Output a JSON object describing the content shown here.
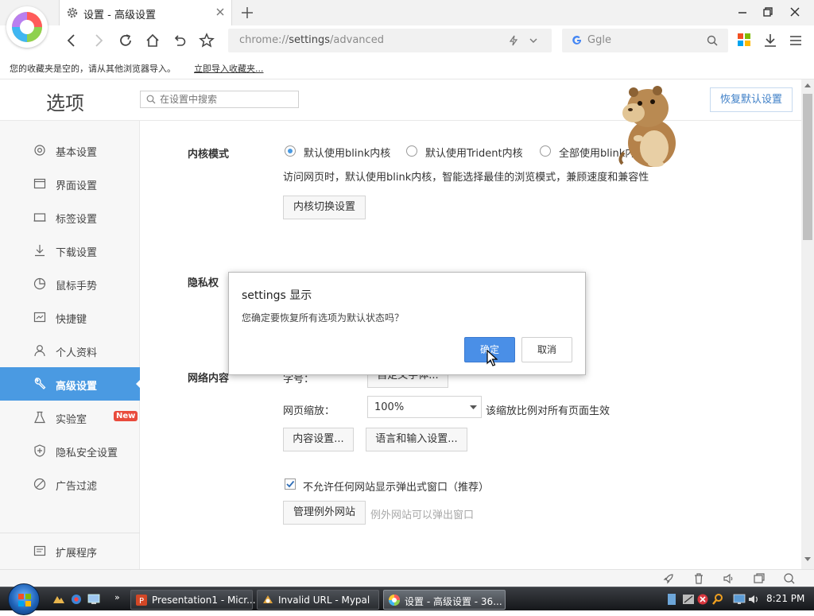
{
  "tab": {
    "title": "设置 - 高级设置"
  },
  "toolbar": {
    "url_prefix": "chrome://",
    "url_host": "settings",
    "url_path": "/advanced",
    "search_placeholder": "Ggle"
  },
  "bookmarks": {
    "empty_text": "您的收藏夹是空的，请从其他浏览器导入。",
    "import_link": "立即导入收藏夹..."
  },
  "settings": {
    "page_title": "选项",
    "search_placeholder": "在设置中搜索",
    "restore_button": "恢复默认设置"
  },
  "sidebar": {
    "items": [
      {
        "label": "基本设置",
        "icon": "gear-icon"
      },
      {
        "label": "界面设置",
        "icon": "window-icon"
      },
      {
        "label": "标签设置",
        "icon": "tab-icon"
      },
      {
        "label": "下载设置",
        "icon": "download-icon"
      },
      {
        "label": "鼠标手势",
        "icon": "mouse-icon"
      },
      {
        "label": "快捷键",
        "icon": "keyboard-icon"
      },
      {
        "label": "个人资料",
        "icon": "user-icon"
      },
      {
        "label": "高级设置",
        "icon": "wrench-icon",
        "active": true
      },
      {
        "label": "实验室",
        "icon": "flask-icon",
        "badge": "New"
      },
      {
        "label": "隐私安全设置",
        "icon": "shield-icon"
      },
      {
        "label": "广告过滤",
        "icon": "block-icon"
      },
      {
        "label": "扩展程序",
        "icon": "extension-icon"
      }
    ]
  },
  "kernel": {
    "title": "内核模式",
    "options": [
      "默认使用blink内核",
      "默认使用Trident内核",
      "全部使用blink内核"
    ],
    "selected_index": 0,
    "description": "访问网页时，默认使用blink内核，智能选择最佳的浏览模式，兼顾速度和兼容性",
    "switch_button": "内核切换设置"
  },
  "privacy": {
    "title": "隐私权"
  },
  "web_content": {
    "title": "网络内容",
    "font_label": "字号：",
    "custom_font_button": "自定义字体...",
    "zoom_label": "网页缩放：",
    "zoom_value": "100%",
    "zoom_note": "该缩放比例对所有页面生效",
    "content_settings_button": "内容设置...",
    "language_button": "语言和输入设置...",
    "popup_checkbox_label": "不允许任何网站显示弹出式窗口（推荐）",
    "popup_checked": true,
    "manage_exceptions_button": "管理例外网站",
    "exceptions_note": "例外网站可以弹出窗口"
  },
  "dialog": {
    "title": "settings 显示",
    "message": "您确定要恢复所有选项为默认状态吗？",
    "ok": "确定",
    "cancel": "取消"
  },
  "taskbar": {
    "buttons": [
      {
        "label": "Presentation1 - Micr...",
        "icon": "powerpoint-icon"
      },
      {
        "label": "Invalid URL - Mypal",
        "icon": "mypal-icon"
      },
      {
        "label": "设置 - 高级设置 - 36...",
        "icon": "browser-icon",
        "active": true
      }
    ],
    "clock": "8:21 PM"
  },
  "colors": {
    "accent": "#4a9ae2",
    "badge": "#e94b3c",
    "ok_button": "#4a8fe7"
  }
}
